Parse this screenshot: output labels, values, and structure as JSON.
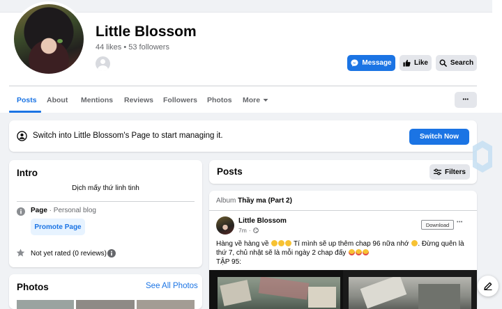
{
  "page": {
    "name": "Little Blossom",
    "stats": "44 likes • 53 followers"
  },
  "actions": {
    "message": "Message",
    "like": "Like",
    "search": "Search"
  },
  "tabs": [
    {
      "label": "Posts"
    },
    {
      "label": "About"
    },
    {
      "label": "Mentions"
    },
    {
      "label": "Reviews"
    },
    {
      "label": "Followers"
    },
    {
      "label": "Photos"
    },
    {
      "label": "More"
    }
  ],
  "more_dots": "•••",
  "switch_bar": {
    "text": "Switch into Little Blossom's Page to start managing it.",
    "button": "Switch Now"
  },
  "intro": {
    "title": "Intro",
    "bio": "Dịch mấy thứ linh tinh",
    "page_label": "Page",
    "page_category": " · Personal blog",
    "promote": "Promote Page",
    "rating": "Not yet rated (0 reviews)"
  },
  "photos": {
    "title": "Photos",
    "see_all": "See All Photos"
  },
  "posts": {
    "title": "Posts",
    "filters": "Filters"
  },
  "post": {
    "album_prefix": "Album",
    "album_name": "Thầy ma (Part 2)",
    "author": "Little Blossom",
    "time": "7m",
    "download": "Download",
    "dots": "•••",
    "text_1a": "Hàng về hàng về",
    "text_1b": "Tí mình sẽ up thêm chap 96 nữa nhớ",
    "text_1c": ". Đừng quên là",
    "text_2a": "thứ 7, chủ nhật sẽ là mỗi ngày 2 chap đấy",
    "text_3": "TẬP 95:"
  },
  "colors": {
    "accent": "#1b74e4",
    "background": "#f0f2f5",
    "muted_text": "#65676b"
  },
  "icons": [
    "messenger-icon",
    "thumbs-up-icon",
    "search-icon",
    "chevron-down-icon",
    "switch-profile-icon",
    "info-icon",
    "star-icon",
    "filter-icon",
    "globe-icon",
    "edit-icon"
  ]
}
